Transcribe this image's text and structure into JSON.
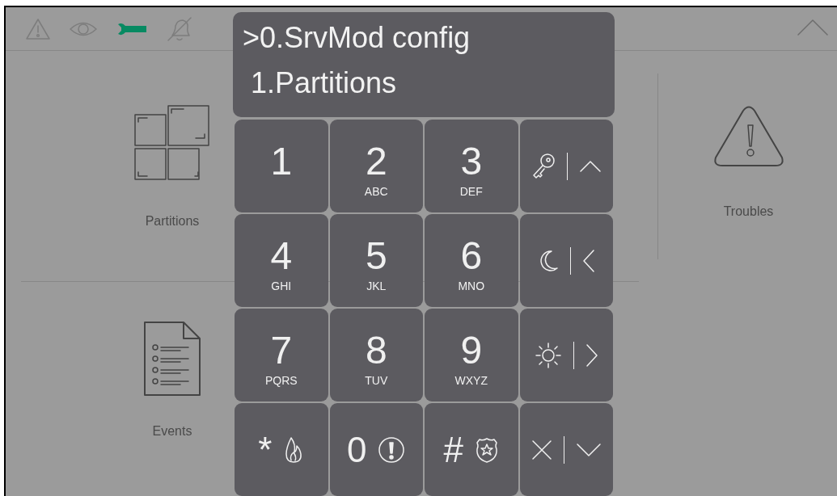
{
  "status_icons": [
    {
      "kind": "warning",
      "active": false
    },
    {
      "kind": "eye",
      "active": false
    },
    {
      "kind": "wrench",
      "active": true
    },
    {
      "kind": "bell-off",
      "active": false
    }
  ],
  "tiles": [
    {
      "kind": "partitions",
      "label": "Partitions"
    },
    {
      "kind": "troubles",
      "label": "Troubles"
    },
    {
      "kind": "events",
      "label": "Events"
    }
  ],
  "display": {
    "lines": [
      ">0.SrvMod config",
      " 1.Partitions"
    ]
  },
  "keys": [
    {
      "kind": "digit",
      "label": "1"
    },
    {
      "kind": "digit",
      "label": "2",
      "letters": "ABC"
    },
    {
      "kind": "digit",
      "label": "3",
      "letters": "DEF"
    },
    {
      "kind": "key-up"
    },
    {
      "kind": "digit",
      "label": "4",
      "letters": "GHI"
    },
    {
      "kind": "digit",
      "label": "5",
      "letters": "JKL"
    },
    {
      "kind": "digit",
      "label": "6",
      "letters": "MNO"
    },
    {
      "kind": "moon-left"
    },
    {
      "kind": "digit",
      "label": "7",
      "letters": "PQRS"
    },
    {
      "kind": "digit",
      "label": "8",
      "letters": "TUV"
    },
    {
      "kind": "digit",
      "label": "9",
      "letters": "WXYZ"
    },
    {
      "kind": "sun-right"
    },
    {
      "kind": "fire",
      "label": "*"
    },
    {
      "kind": "alarm",
      "label": "0"
    },
    {
      "kind": "police",
      "label": "#"
    },
    {
      "kind": "cancel-down"
    }
  ]
}
